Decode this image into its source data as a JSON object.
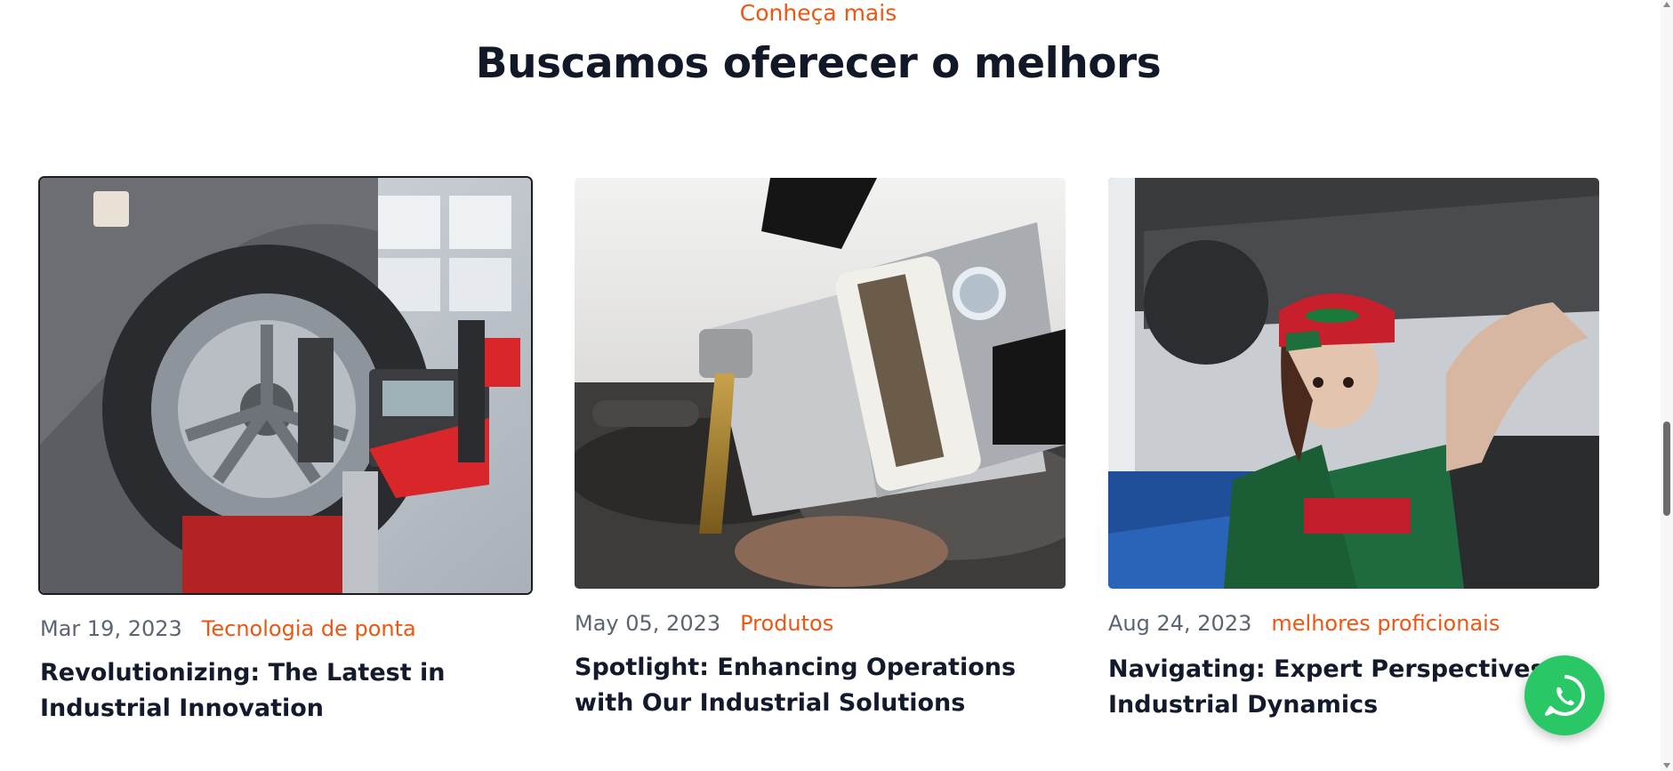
{
  "section": {
    "eyebrow": "Conheça mais",
    "headline": "Buscamos oferecer o melhors"
  },
  "posts": [
    {
      "date": "Mar 19, 2023",
      "category": "Tecnologia de ponta",
      "title": "Revolutionizing: The Latest in Industrial Innovation",
      "image_subject": "wheel-alignment-machine-photo"
    },
    {
      "date": "May 05, 2023",
      "category": "Produtos",
      "title": "Spotlight: Enhancing Operations with Our Industrial Solutions",
      "image_subject": "engine-oil-pouring-photo"
    },
    {
      "date": "Aug 24, 2023",
      "category": "melhores proficionais",
      "title": "Navigating: Expert Perspectives on Industrial Dynamics",
      "image_subject": "female-mechanic-under-car-photo"
    }
  ],
  "floating": {
    "whatsapp_icon": "whatsapp-icon"
  },
  "colors": {
    "accent": "#ee5612",
    "heading": "#111827",
    "meta": "#5b6472",
    "whatsapp": "#29c766"
  }
}
